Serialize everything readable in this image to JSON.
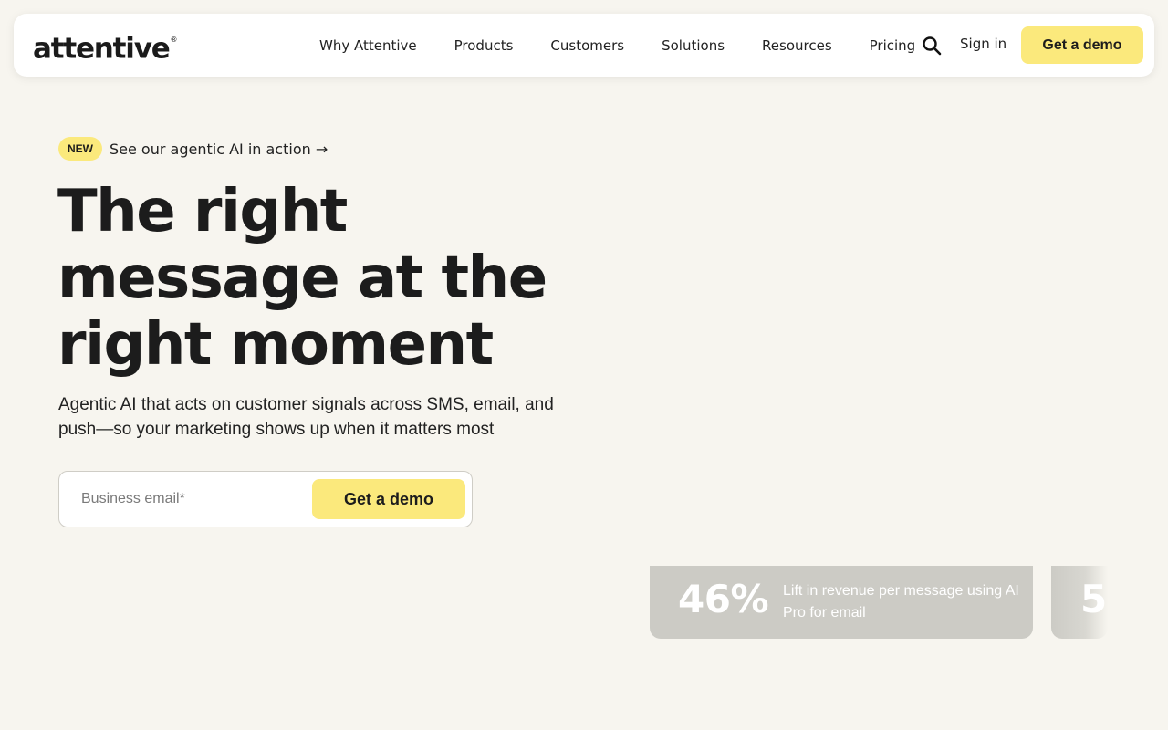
{
  "nav": {
    "logo": "attentive",
    "logo_mark": "®",
    "links": [
      "Why Attentive",
      "Products",
      "Customers",
      "Solutions",
      "Resources",
      "Pricing"
    ],
    "search_icon": "search-icon",
    "sign_in": "Sign in",
    "cta": "Get a demo"
  },
  "hero": {
    "badge": "NEW",
    "announcement": "See our agentic AI in action →",
    "title_lines": [
      "The right",
      "message at the",
      "right moment"
    ],
    "subtitle": "Agentic AI that acts on customer signals across SMS, email, and push—so your marketing shows up when it matters most",
    "email_placeholder": "Business email*",
    "cta": "Get a demo"
  },
  "stats": [
    {
      "value": "46%",
      "label": "Lift in revenue per message using AI Pro for email"
    },
    {
      "value": "5",
      "label": ""
    }
  ],
  "colors": {
    "background": "#f7f5ef",
    "accent_yellow": "#fbe97c",
    "stat_card": "#cccbc5",
    "text": "#1c1c1c"
  }
}
